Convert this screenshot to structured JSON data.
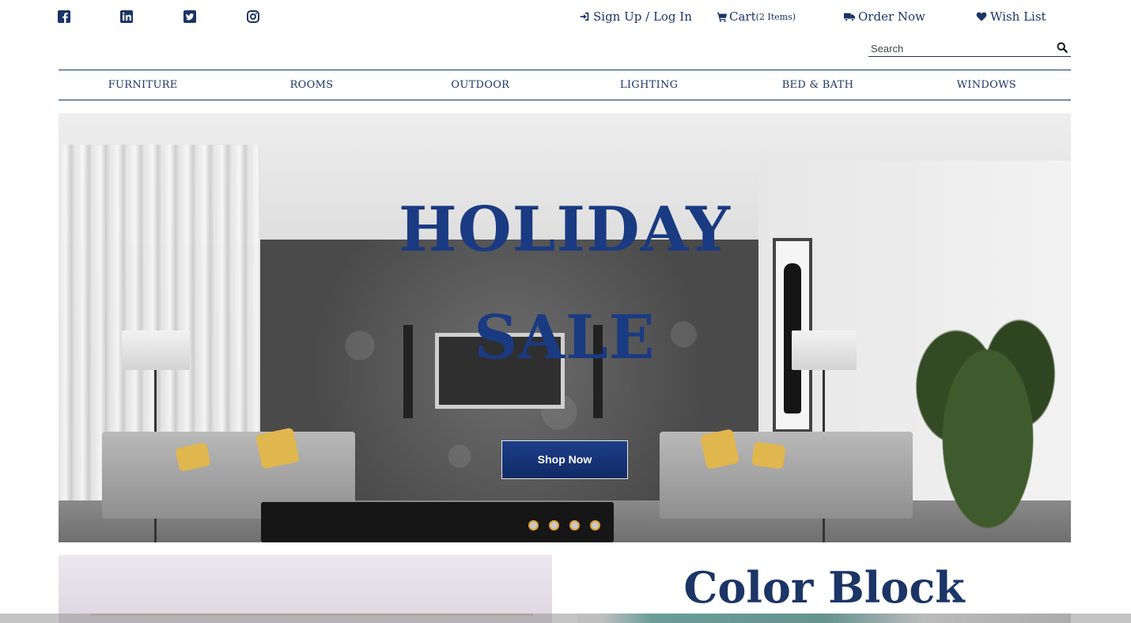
{
  "social": [
    {
      "name": "facebook-icon"
    },
    {
      "name": "linkedin-icon"
    },
    {
      "name": "twitter-icon"
    },
    {
      "name": "instagram-icon"
    }
  ],
  "utility": {
    "signup_label": "Sign Up / Log In",
    "cart_label": "Cart",
    "cart_count": "(2 Items)",
    "order_label": "Order Now",
    "wishlist_label": "Wish List"
  },
  "search": {
    "placeholder": "Search"
  },
  "nav": [
    "FURNITURE",
    "ROOMS",
    "OUTDOOR",
    "LIGHTING",
    "BED & BATH",
    "WINDOWS"
  ],
  "hero": {
    "title_line1": "HOLIDAY",
    "title_line2": "SALE",
    "cta_label": "Shop Now",
    "slide_count": 4
  },
  "promo": {
    "title": "Color Block"
  },
  "colors": {
    "brand": "#1a3566",
    "accent_dot": "#e3a233",
    "button": "#1e3e8a"
  }
}
